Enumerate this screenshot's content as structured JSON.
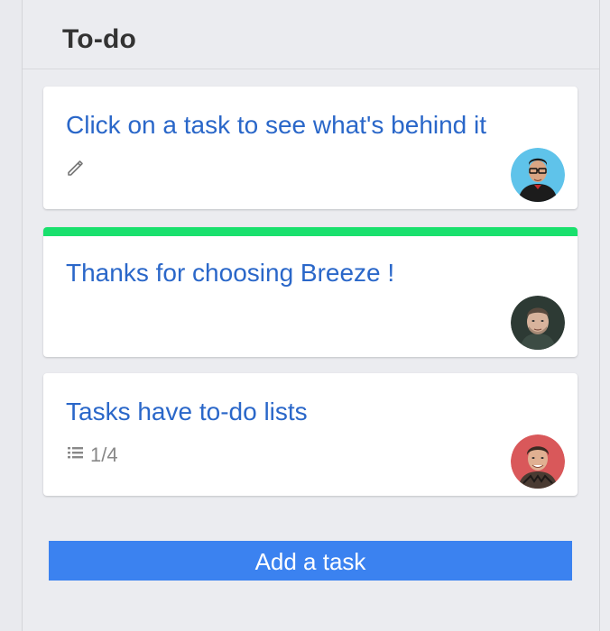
{
  "column": {
    "title": "To-do"
  },
  "cards": [
    {
      "title": "Click on a task to see what's behind it",
      "indicator_icon": "pencil-icon",
      "has_stripe": false
    },
    {
      "title": "Thanks for choosing Breeze !",
      "stripe_color": "#19e06d",
      "has_stripe": true
    },
    {
      "title": "Tasks have to-do lists",
      "indicator_icon": "checklist-icon",
      "checklist_progress": "1/4",
      "has_stripe": false
    }
  ],
  "add_task": {
    "label": "Add a task"
  },
  "colors": {
    "title_text": "#2a67c9",
    "accent_button": "#3b82f0",
    "label_stripe": "#19e06d",
    "background": "#ebecf0"
  }
}
